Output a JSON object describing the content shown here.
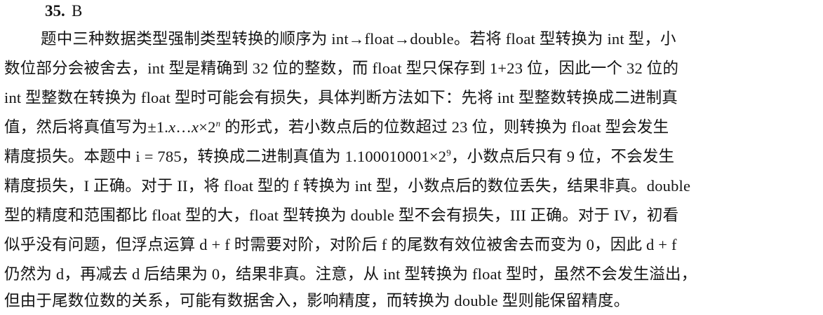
{
  "question": {
    "number": "35.",
    "answer": "B"
  },
  "paragraph": {
    "lines": [
      "题中三种数据类型强制类型转换的顺序为 int→float→double。若将 float 型转换为 int 型，小",
      "数位部分会被舍去，int 型是精确到 32 位的整数，而 float 型只保存到 1+23 位，因此一个 32 位的",
      "int 型整数在转换为 float 型时可能会有损失，具体判断方法如下：先将 int 型整数转换成二进制真",
      "值，然后将真值写为",
      "±1.",
      "x",
      "…",
      "x",
      "×2",
      "n",
      " 的形式，若小数点后的位数超过 23 位，则转换为 float 型会发生",
      "精度损失。本题中 i = 785，转换成二进制真值为 1.100010001×2",
      "9",
      "，小数点后只有 9 位，不会发生",
      "精度损失，I 正确。对于 II，将 float 型的 f 转换为 int 型，小数点后的数位丢失，结果非真。double",
      "型的精度和范围都比 float 型的大，float 型转换为 double 型不会有损失，III 正确。对于 IV，初看",
      "似乎没有问题，但浮点运算 d + f 时需要对阶，对阶后 f 的尾数有效位被舍去而变为 0，因此 d + f",
      "仍然为 d，再减去 d 后结果为 0，结果非真。注意，从 int 型转换为 float 型时，虽然不会发生溢出，",
      "但由于尾数位数的关系，可能有数据舍入，影响精度，而转换为 double 型则能保留精度。"
    ]
  }
}
